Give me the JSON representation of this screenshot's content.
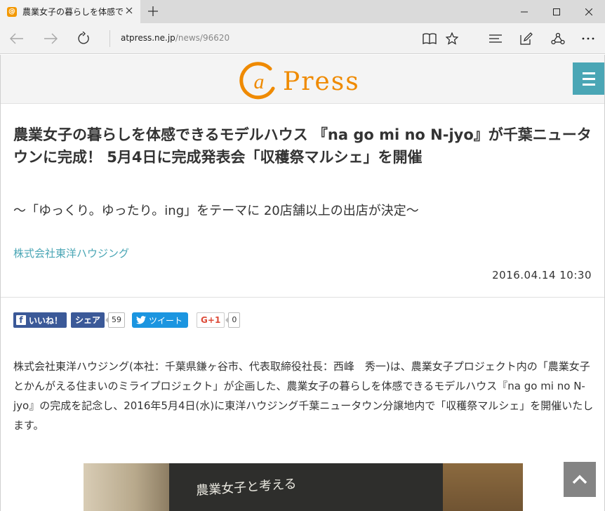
{
  "browser": {
    "tab_title": "農業女子の暮らしを体感で",
    "favicon_letter": "@",
    "url_host": "atpress.ne.jp",
    "url_path": "/news/96620"
  },
  "site": {
    "logo_text": "Press",
    "brand_color": "#ef8a00",
    "accent_color": "#4aa6b5"
  },
  "article": {
    "headline": "農業女子の暮らしを体感できるモデルハウス 『na go mi no N-jyo』が千葉ニュータウンに完成！ 5月4日に完成発表会「収穫祭マルシェ」を開催",
    "subheadline": "～「ゆっくり。ゆったり。ing」をテーマに 20店舗以上の出店が決定～",
    "company": "株式会社東洋ハウジング",
    "date": "2016.04.14 10:30",
    "body": "株式会社東洋ハウジング(本社：千葉県鎌ヶ谷市、代表取締役社長：西峰　秀一)は、農業女子プロジェクト内の「農業女子とかんがえる住まいのミライプロジェクト」が企画した、農業女子の暮らしを体感できるモデルハウス『na go mi no N-jyo』の完成を記念し、2016年5月4日(水)に東洋ハウジング千葉ニュータウン分譲地内で「収穫祭マルシェ」を開催いたします。",
    "photo_chalk_text": "農業女子と考える"
  },
  "social": {
    "fb_like_label": "いいね！",
    "fb_share_label": "シェア",
    "fb_share_count": "59",
    "tweet_label": "ツイート",
    "gplus_label": "G+1",
    "gplus_count": "0"
  }
}
